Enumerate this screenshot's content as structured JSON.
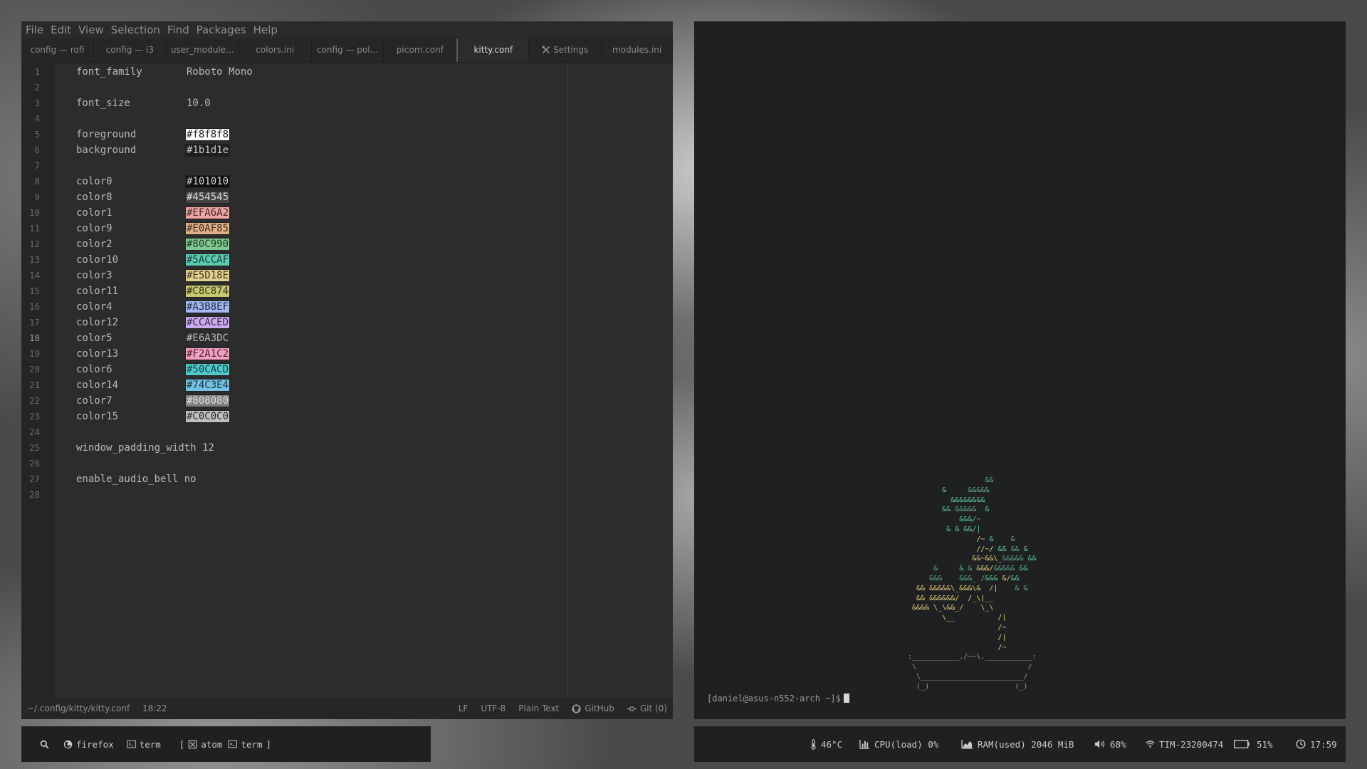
{
  "editor": {
    "menu": [
      "File",
      "Edit",
      "View",
      "Selection",
      "Find",
      "Packages",
      "Help"
    ],
    "tabs": [
      {
        "label": "config — rofi",
        "icon": ""
      },
      {
        "label": "config — i3",
        "icon": ""
      },
      {
        "label": "user_module...",
        "icon": ""
      },
      {
        "label": "colors.ini",
        "icon": ""
      },
      {
        "label": "config — pol...",
        "icon": ""
      },
      {
        "label": "picom.conf",
        "icon": ""
      },
      {
        "label": "kitty.conf",
        "icon": "",
        "active": true
      },
      {
        "label": "Settings",
        "icon": "tools-icon"
      },
      {
        "label": "modules.ini",
        "icon": ""
      }
    ],
    "lines": [
      {
        "n": "1",
        "key": "font_family",
        "val": "Roboto Mono"
      },
      {
        "n": "2",
        "key": "",
        "val": ""
      },
      {
        "n": "3",
        "key": "font_size",
        "val": "10.0"
      },
      {
        "n": "4",
        "key": "",
        "val": ""
      },
      {
        "n": "5",
        "key": "foreground",
        "val": "#f8f8f8",
        "swatch": "#f8f8f8",
        "fg": "#1b1d1e"
      },
      {
        "n": "6",
        "key": "background",
        "val": "#1b1d1e",
        "swatch": "#1b1d1e",
        "fg": "#c8c8c8"
      },
      {
        "n": "7",
        "key": "",
        "val": ""
      },
      {
        "n": "8",
        "key": "color0",
        "val": "#101010",
        "swatch": "#101010",
        "fg": "#d0d0d0"
      },
      {
        "n": "9",
        "key": "color8",
        "val": "#454545",
        "swatch": "#454545",
        "fg": "#d8d8d8"
      },
      {
        "n": "10",
        "key": "color1",
        "val": "#EFA6A2",
        "swatch": "#EFA6A2",
        "fg": "#3a2a2a"
      },
      {
        "n": "11",
        "key": "color9",
        "val": "#E0AF85",
        "swatch": "#E0AF85",
        "fg": "#3a2e20"
      },
      {
        "n": "12",
        "key": "color2",
        "val": "#80C990",
        "swatch": "#80C990",
        "fg": "#203a26"
      },
      {
        "n": "13",
        "key": "color10",
        "val": "#5ACCAF",
        "swatch": "#5ACCAF",
        "fg": "#1c3a32"
      },
      {
        "n": "14",
        "key": "color3",
        "val": "#E5D18E",
        "swatch": "#E5D18E",
        "fg": "#3a3420"
      },
      {
        "n": "15",
        "key": "color11",
        "val": "#C8C874",
        "swatch": "#C8C874",
        "fg": "#35351c"
      },
      {
        "n": "16",
        "key": "color4",
        "val": "#A3B8EF",
        "swatch": "#A3B8EF",
        "fg": "#232c44"
      },
      {
        "n": "17",
        "key": "color12",
        "val": "#CCACED",
        "swatch": "#CCACED",
        "fg": "#352844"
      },
      {
        "n": "18",
        "key": "color5",
        "val": "#E6A3DC",
        "swatch": "",
        "fg": "#b8b8b8"
      },
      {
        "n": "19",
        "key": "color13",
        "val": "#F2A1C2",
        "swatch": "#F2A1C2",
        "fg": "#40222f"
      },
      {
        "n": "20",
        "key": "color6",
        "val": "#50CACD",
        "swatch": "#50CACD",
        "fg": "#1a3b3c"
      },
      {
        "n": "21",
        "key": "color14",
        "val": "#74C3E4",
        "swatch": "#74C3E4",
        "fg": "#1d3542"
      },
      {
        "n": "22",
        "key": "color7",
        "val": "#808080",
        "swatch": "#808080",
        "fg": "#e0e0e0"
      },
      {
        "n": "23",
        "key": "color15",
        "val": "#C0C0C0",
        "swatch": "#C0C0C0",
        "fg": "#2a2a2a"
      },
      {
        "n": "24",
        "key": "",
        "val": ""
      },
      {
        "n": "25",
        "key": "window_padding_width 12",
        "val": "",
        "plain": true
      },
      {
        "n": "26",
        "key": "",
        "val": ""
      },
      {
        "n": "27",
        "key": "enable_audio_bell no",
        "val": "",
        "plain": true
      },
      {
        "n": "28",
        "key": "",
        "val": ""
      }
    ],
    "status": {
      "path": "~/.config/kitty/kitty.conf",
      "cursor": "18:22",
      "line_ending": "LF",
      "encoding": "UTF-8",
      "grammar": "Plain Text",
      "github": "GitHub",
      "git": "Git (0)"
    }
  },
  "terminal": {
    "prompt": "[daniel@asus-n552-arch ~]$",
    "bonsai": [
      {
        "parts": [
          [
            "                  &&",
            "dg"
          ]
        ]
      },
      {
        "parts": [
          [
            "        &     ",
            "g"
          ],
          [
            "&&&&&",
            "dg"
          ]
        ]
      },
      {
        "parts": [
          [
            "          &&&&&&&&",
            "g"
          ]
        ]
      },
      {
        "parts": [
          [
            "        && ",
            "g"
          ],
          [
            "&&&&&  ",
            "dg"
          ],
          [
            "&",
            "g"
          ]
        ]
      },
      {
        "parts": [
          [
            "            &&&/~",
            "g"
          ]
        ]
      },
      {
        "parts": [
          [
            "         & & ",
            "g"
          ],
          [
            "&&/|",
            "g"
          ]
        ]
      },
      {
        "parts": [
          [
            "                /~ ",
            "y"
          ],
          [
            "&",
            "g"
          ],
          [
            "    &",
            "dg"
          ]
        ]
      },
      {
        "parts": [
          [
            "                //~/ ",
            "y"
          ],
          [
            "&& ",
            "g"
          ],
          [
            "&& ",
            "dg"
          ],
          [
            "&",
            "g"
          ]
        ]
      },
      {
        "parts": [
          [
            "               &&~&&\\_",
            "y"
          ],
          [
            "&&&&& ",
            "dg"
          ],
          [
            "&&",
            "g"
          ]
        ]
      },
      {
        "parts": [
          [
            "      &     ",
            "dg"
          ],
          [
            "& ",
            "g"
          ],
          [
            "& ",
            "dg"
          ],
          [
            "&&&/",
            "y"
          ],
          [
            "&&&&& ",
            "dg"
          ],
          [
            "&&",
            "g"
          ]
        ]
      },
      {
        "parts": [
          [
            "     &&&    &&&_ /",
            "dg"
          ],
          [
            "&&& ",
            "g"
          ],
          [
            "&/",
            "y"
          ],
          [
            "&&",
            "g"
          ]
        ]
      },
      {
        "parts": [
          [
            "  && &&&&&\\_&&&\\&  /|    ",
            "y"
          ],
          [
            "& &",
            "dg"
          ]
        ]
      },
      {
        "parts": [
          [
            "  && &&&&&&/  /_\\|__",
            "y"
          ]
        ]
      },
      {
        "parts": [
          [
            " &&&& \\_\\&&_/    \\_\\",
            "y"
          ]
        ]
      },
      {
        "parts": [
          [
            "        \\__          /|",
            "y"
          ]
        ]
      },
      {
        "parts": [
          [
            "                     /~",
            "y"
          ]
        ]
      },
      {
        "parts": [
          [
            "                     /|",
            "y"
          ]
        ]
      },
      {
        "parts": [
          [
            "                     /~",
            "y"
          ]
        ]
      },
      {
        "parts": [
          [
            ":___________./~~\\.___________:",
            "gr"
          ]
        ]
      },
      {
        "parts": [
          [
            " \\                          /",
            "gr"
          ]
        ]
      },
      {
        "parts": [
          [
            "  \\________________________/",
            "gr"
          ]
        ]
      },
      {
        "parts": [
          [
            "  (_)                    (_)",
            "gr"
          ]
        ]
      }
    ]
  },
  "taskbar": {
    "items": [
      {
        "icon": "search-icon",
        "label": ""
      },
      {
        "icon": "firefox-icon",
        "label": "firefox"
      },
      {
        "icon": "terminal-icon",
        "label": "term"
      },
      {
        "icon": "atom-icon",
        "label": "[  atom"
      },
      {
        "icon": "terminal-icon",
        "label": "term  ]"
      }
    ]
  },
  "sysbar": {
    "temp": "46°C",
    "cpu": "CPU(load) 0%",
    "ram": "RAM(used) 2046 MiB",
    "volume": "68%",
    "wifi": "TIM-23200474",
    "battery": "51%",
    "clock": "17:59"
  }
}
